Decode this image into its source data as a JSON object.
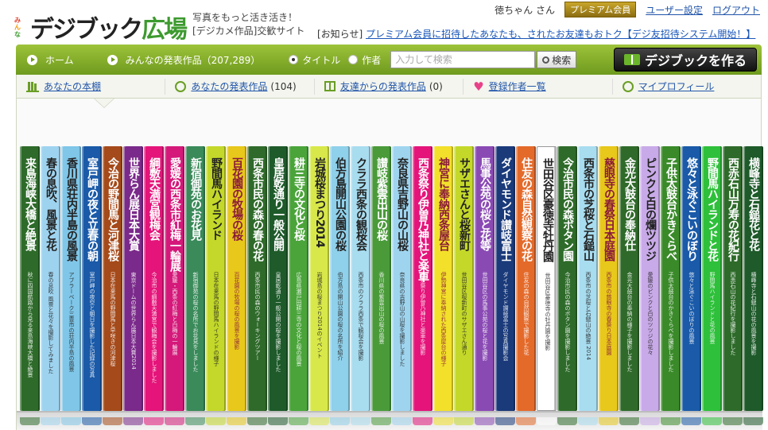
{
  "logo": {
    "mini": [
      "み",
      "ん",
      "な"
    ],
    "main_a": "デジブック",
    "main_b": "広場"
  },
  "tagline": {
    "line1": "写真をもっと活き活き！",
    "line2": "[デジカメ作品]交歓サイト"
  },
  "user": {
    "name": "徳ちゃん さん",
    "badge": "プレミアム会員",
    "settings": "ユーザー設定",
    "logout": "ログアウト"
  },
  "notice": {
    "prefix": "[お知らせ]",
    "link": "プレミアム会員に招待したあなたも、されたお友達もおトク【デジ友招待システム開始！】"
  },
  "nav": {
    "home": "ホーム",
    "works": "みんなの発表作品（207,289）",
    "radio_title": "タイトル",
    "radio_author": "作者",
    "search_placeholder": "入力して検索",
    "search_btn": "検索",
    "create_btn": "デジブックを作る"
  },
  "tabs": [
    {
      "label": "あなたの本棚",
      "count": ""
    },
    {
      "label": "あなたの発表作品",
      "count": "(104)"
    },
    {
      "label": "友達からの発表作品",
      "count": "(0)"
    },
    {
      "label": "登録作者一覧",
      "count": ""
    },
    {
      "label": "マイプロフィール",
      "count": ""
    }
  ],
  "books": [
    {
      "title": "来島海峡大橋と絶景",
      "sub": "秋に四国航路から見る来島海峡大橋と絶景",
      "color": "#2e6b2a",
      "fg": "#ffffff"
    },
    {
      "title": "春の息吹、風景と花",
      "sub": "春の息吹 風景と花々を撮影してみました",
      "color": "#9ed3ef",
      "fg": "#222222"
    },
    {
      "title": "香川県荘内半島の風景",
      "sub": "アブラーベーク三豊市の荘内半島の風景",
      "color": "#7fc6e8",
      "fg": "#222222"
    },
    {
      "title": "室戸岬の夜と立春の朝",
      "sub": "室戸岬の夜空と朝日を撮影した記録の写真",
      "color": "#1a5aa8",
      "fg": "#ffffff"
    },
    {
      "title": "今治の野間馬と河津桜",
      "sub": "日本在来馬の野間馬と早咲きの河津桜",
      "color": "#a54a1a",
      "fg": "#ffffff"
    },
    {
      "title": "世界らん展日本大賞",
      "sub": "東京ドームの世界らん展日本大賞2014",
      "color": "#7a2a8a",
      "fg": "#ffffff"
    },
    {
      "title": "綱敷天満宮観梅会",
      "sub": "今治市の綱敷天満宮で観梅会を撮影しました",
      "color": "#e4147a",
      "fg": "#ffffff"
    },
    {
      "title": "愛媛の西条市紅梅一輪展",
      "sub": "愛媛・西条の紅梅と白梅の一輪展",
      "color": "#d4197a",
      "fg": "#ffffff"
    },
    {
      "title": "新宿御苑のお花見",
      "sub": "新宿御苑の桜の名所でお花見をしました",
      "color": "#3a8a5a",
      "fg": "#ffffff"
    },
    {
      "title": "野間馬ハイランド",
      "sub": "日本在来馬の野間馬ハイランドの様子",
      "color": "#c3d82a",
      "fg": "#222222"
    },
    {
      "title": "百花園の牧場の桜",
      "sub": "百花園の牧場の桜の風景を撮影",
      "color": "#e8c81a",
      "fg": "#8a1a3a"
    },
    {
      "title": "西条市民の森の春の花",
      "sub": "西条市民の森のウォーキングツアー",
      "color": "#2f6a2a",
      "fg": "#ffffff"
    },
    {
      "title": "皇居乾通り一般公開",
      "sub": "皇居乾通り一般公開の桜を撮影しました",
      "color": "#1e5a2a",
      "fg": "#ffffff"
    },
    {
      "title": "耕三寺の文化と桜",
      "sub": "広島県瀬戸田耕三寺の文化と桜の風景",
      "color": "#4aa43a",
      "fg": "#ffffff"
    },
    {
      "title": "岩城桜まつり2014",
      "sub": "岩城島の桜まつり2014のイベント",
      "color": "#d8e84a",
      "fg": "#222222"
    },
    {
      "title": "伯方島開山公園の桜",
      "sub": "伯方島の開山公園の桜の名所を紹介",
      "color": "#8fd0ea",
      "fg": "#222222"
    },
    {
      "title": "クララ西条の観桜会",
      "sub": "西条市のクララ西条で観桜会を撮影",
      "color": "#a8dcef",
      "fg": "#222222"
    },
    {
      "title": "讃岐紫雲出山の桜",
      "sub": "香川県の紫雲出山の桜の風景",
      "color": "#4a9a3a",
      "fg": "#ffffff"
    },
    {
      "title": "奈良県吉野山の山桜",
      "sub": "奈良県の吉野山の山桜を撮影しました",
      "color": "#9fd4ef",
      "fg": "#222222"
    },
    {
      "title": "西条祭り伊曽乃神社と楽車",
      "sub": "西条祭り伊曽乃神社と楽車を撮影",
      "color": "#e4147a",
      "fg": "#ffffff"
    },
    {
      "title": "神宮に奉納西条屋台",
      "sub": "伊勢神宮に奉納された西条屋台の様子",
      "color": "#f2e02a",
      "fg": "#8a1a3a"
    },
    {
      "title": "サザエさんと桜新町",
      "sub": "世田谷区桜新町のサザエさん通り",
      "color": "#c4d82a",
      "fg": "#222222"
    },
    {
      "title": "馬事公苑の桜と花等",
      "sub": "世田谷区の馬事公苑の桜と花を撮影",
      "color": "#8a4ab4",
      "fg": "#ffffff"
    },
    {
      "title": "ダイヤモンド讃岐富士",
      "sub": "ダイヤモンド讃岐富士の写真撮影会",
      "color": "#1a3a7a",
      "fg": "#ffffff"
    },
    {
      "title": "住友の森自然観察の花",
      "sub": "住友の森の自然観察で撮影した花",
      "color": "#e46a2a",
      "fg": "#ffffff"
    },
    {
      "title": "世田谷区豪徳寺牡丹園",
      "sub": "世田谷区豪徳寺の牡丹園を撮影",
      "color": "#ffffff",
      "fg": "#222222"
    },
    {
      "title": "今治市民の森ボタン園",
      "sub": "今治市民の森のボタン園を撮影しました",
      "color": "#2e6b2a",
      "fg": "#ffffff"
    },
    {
      "title": "西条市の芝桜と石鎚山",
      "sub": "西条市の芝桜と石鎚山の絶景 2014",
      "color": "#a8dcef",
      "fg": "#222222"
    },
    {
      "title": "慈眼寺の春祭日本庭園",
      "sub": "西条市の慈眼寺の春祭り日本庭園",
      "color": "#e8c81a",
      "fg": "#8a1a3a"
    },
    {
      "title": "金光大鼓台の奉納仕",
      "sub": "金光大鼓台の奉納の様子を撮影しました",
      "color": "#2f6a2a",
      "fg": "#ffffff"
    },
    {
      "title": "ピンクと白の爛ツツジ",
      "sub": "愛媛のピンクと白のツツジの花々",
      "color": "#c8aae8",
      "fg": "#222222"
    },
    {
      "title": "子供太鼓台かきくらべ",
      "sub": "子供太鼓台のかきくらべを撮影しました",
      "color": "#3a8a2a",
      "fg": "#ffffff"
    },
    {
      "title": "悠々と泳ぐこいのぼり",
      "sub": "悠々と泳ぐこいのぼりの風景",
      "color": "#1a5aa8",
      "fg": "#ffffff"
    },
    {
      "title": "野間馬ハイランドと花",
      "sub": "野間馬ハイランドと花の風景",
      "color": "#2ec03a",
      "fg": "#ffffff"
    },
    {
      "title": "西赤石山万寿の花紀行",
      "sub": "西赤石山の花紀行を撮影しました",
      "color": "#2e6b2a",
      "fg": "#ffffff"
    },
    {
      "title": "横峰寺と石鎚花と花",
      "sub": "横峰寺と石鎚山の花の風景を撮影",
      "color": "#1e5a2a",
      "fg": "#ffffff"
    }
  ]
}
